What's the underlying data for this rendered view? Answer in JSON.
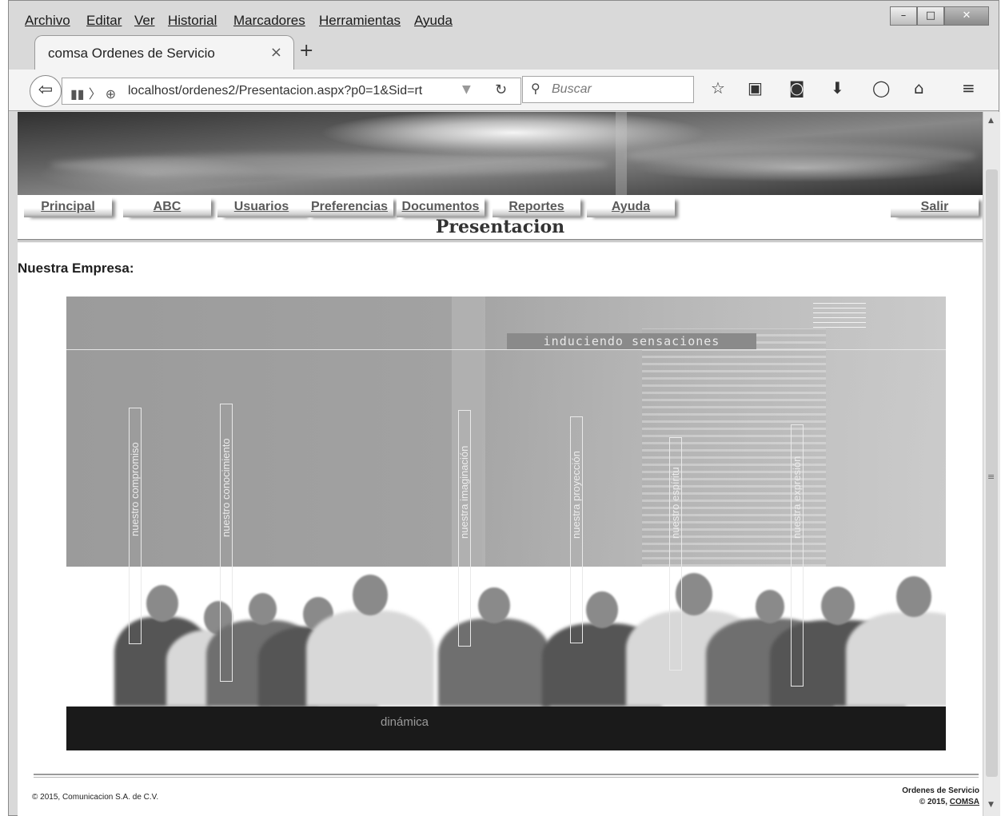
{
  "browser": {
    "menu": [
      "Archivo",
      "Editar",
      "Ver",
      "Historial",
      "Marcadores",
      "Herramientas",
      "Ayuda"
    ],
    "tab_title": "comsa Ordenes de Servicio",
    "url": "localhost/ordenes2/Presentacion.aspx?p0=1&Sid=rt",
    "search_placeholder": "Buscar",
    "icons": [
      "back-icon",
      "library-icon",
      "globe-icon",
      "reload-icon",
      "search-icon",
      "bookmark-star-icon",
      "reading-list-icon",
      "pocket-icon",
      "download-icon",
      "chat-icon",
      "home-icon",
      "hamburger-menu-icon"
    ]
  },
  "nav": {
    "items": [
      "Principal",
      "ABC",
      "Usuarios",
      "Preferencias",
      "Documentos",
      "Reportes",
      "Ayuda"
    ],
    "logout": "Salir"
  },
  "page": {
    "title": "Presentacion",
    "section": "Nuestra Empresa:"
  },
  "collage": {
    "tagline": "induciendo sensaciones",
    "labels": [
      "nuestro compromiso",
      "nuestro conocimiento",
      "nuestra imaginación",
      "nuestra proyección",
      "nuestro espíritu",
      "nuestra expresión"
    ],
    "bottom_word": "dinámica"
  },
  "footer": {
    "copyright_left": "© 2015, Comunicacion S.A. de C.V.",
    "app_name": "Ordenes de Servicio",
    "copyright_right_prefix": "© 2015, ",
    "company_link": "COMSA"
  }
}
